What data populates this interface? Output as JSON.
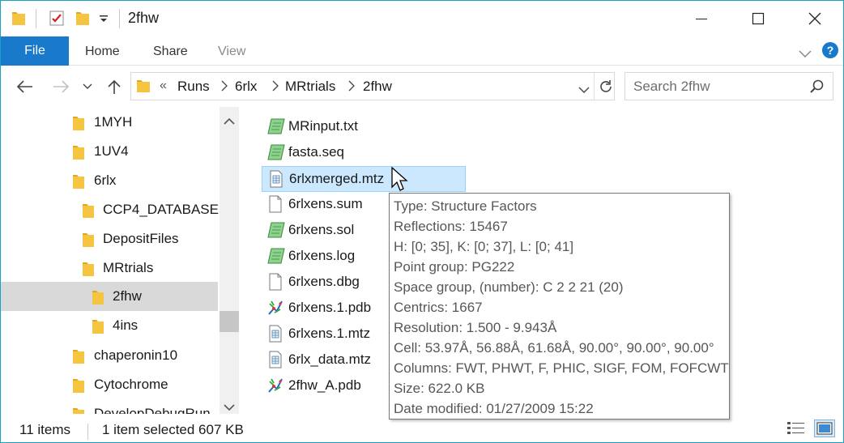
{
  "window": {
    "title": "2fhw"
  },
  "ribbon": {
    "tabs": {
      "file": "File",
      "home": "Home",
      "share": "Share",
      "view": "View"
    }
  },
  "address": {
    "overflow": "«",
    "crumbs": [
      "Runs",
      "6rlx",
      "MRtrials",
      "2fhw"
    ]
  },
  "search": {
    "placeholder": "Search 2fhw"
  },
  "nav": {
    "items": [
      "1MYH",
      "1UV4",
      "6rlx",
      "CCP4_DATABASE",
      "DepositFiles",
      "MRtrials",
      "2fhw",
      "4ins",
      "chaperonin10",
      "Cytochrome",
      "DevelopDebugRun"
    ]
  },
  "files": [
    {
      "name": "MRinput.txt",
      "icon": "notepad-icon"
    },
    {
      "name": "fasta.seq",
      "icon": "notepad-icon"
    },
    {
      "name": "6rlxmerged.mtz",
      "icon": "data-file-icon"
    },
    {
      "name": "6rlxens.sum",
      "icon": "blank-file-icon"
    },
    {
      "name": "6rlxens.sol",
      "icon": "notepad-icon"
    },
    {
      "name": "6rlxens.log",
      "icon": "notepad-icon"
    },
    {
      "name": "6rlxens.dbg",
      "icon": "blank-file-icon"
    },
    {
      "name": "6rlxens.1.pdb",
      "icon": "molecule-icon"
    },
    {
      "name": "6rlxens.1.mtz",
      "icon": "data-file-icon"
    },
    {
      "name": "6rlx_data.mtz",
      "icon": "data-file-icon"
    },
    {
      "name": "2fhw_A.pdb",
      "icon": "molecule-icon"
    }
  ],
  "tooltip": {
    "lines": [
      "Type: Structure Factors",
      "Reflections: 15467",
      "H: [0; 35], K: [0; 37], L: [0; 41]",
      "Point group: PG222",
      "Space group, (number): C 2 2 21 (20)",
      "Centrics: 1667",
      "Resolution: 1.500 - 9.943Å",
      "Cell: 53.97Å, 56.88Å, 61.68Å, 90.00°, 90.00°, 90.00°",
      "Columns: FWT, PHWT, F, PHIC, SIGF, FOM, FOFCWT",
      "Size: 622.0 KB",
      "Date modified: 01/27/2009  15:22"
    ]
  },
  "status": {
    "count": "11 items",
    "selection": "1 item selected  607 KB"
  },
  "colors": {
    "accent": "#1979ca",
    "border": "#1ba1bf",
    "folder": "#f5c542",
    "selection": "#cce8ff"
  }
}
